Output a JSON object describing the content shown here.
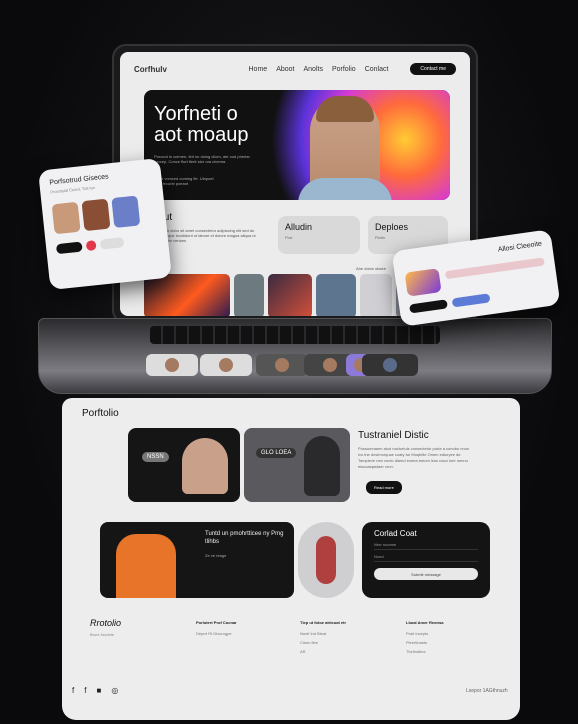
{
  "nav": {
    "logo": "Corfhulv",
    "links": [
      "Home",
      "Aboot",
      "Anolts",
      "Porfolio",
      "Conlact"
    ],
    "cta": "Contact me"
  },
  "hero": {
    "title_line1": "Yorfneti o",
    "title_line2": "aot moaup",
    "subtitle": "Porocut in ocirnen, tinf on doing cliom, ate ood pheriar roocep. Conce flurt flerit stor ora cinema.",
    "small": "Bloor voniced coming fie. Uinpoet coat fecurle poeant"
  },
  "about": {
    "title": "About",
    "text": "Lorem ipsum dolor sit amet consectetur adipiscing elit sed do eiusmod tempor incididunt ut labore et dolore magna aliqua ut enim ad minim veniam"
  },
  "cards": [
    {
      "title": "Alludin",
      "small": "Prot"
    },
    {
      "title": "Deploes",
      "small": "Plotin"
    }
  ],
  "strip_labels": {
    "left": "Porfolio",
    "mid": "Ahe doice obsee",
    "right": "Aus doe"
  },
  "float_left": {
    "title": "Porfsotrud Giseces",
    "sub": "Prosrtiulal Ceant, Tiat tun"
  },
  "float_right": {
    "title": "Allosi Cleeoite"
  },
  "portfolio": {
    "title": "Porftolio",
    "badge1": "NSSN",
    "badge2": "GLO LOEA"
  },
  "feature": {
    "heading": "Tustraniel Distic",
    "text": "Possumnaem alod nacturtuls consectetur porta a conobu nnon ivo tne dovimorquse coaty tur Moqtelle Omen edloryee de. Tamplexe nen vnnio dlamd eveea tneum lsns naco lore nennu eiscoalqasfaer vrnn.",
    "btn": "Read more"
  },
  "quote": {
    "text": "Tuntd un pmohrtticee ny Pmg tlihbs",
    "small": "Ze ve reage"
  },
  "contact": {
    "title": "Corlad Coat",
    "field1": "Nrer noomm",
    "field2": "Nond",
    "send": "Submit message"
  },
  "footer": {
    "brand": "Rrotolio",
    "brand_sub": "Brure fourlcte",
    "col1": {
      "title": "Porlotert Prof Cocnar",
      "items": [
        "Deprrt Rt Dlocrogpe"
      ]
    },
    "col2": {
      "title": "Tlep ut fotoe atrtcoat etr",
      "items": [
        "Nunlt Ind Bleat",
        "Cliorn flee",
        "AR"
      ]
    },
    "col3": {
      "title": "Lboal Amer Reonsa",
      "items": [
        "Prait Incepts",
        "Pleertinants",
        "Tlorlindleor"
      ]
    },
    "social": [
      "f",
      "f",
      "■",
      "◎"
    ],
    "copyright": "Lsepor 1AGthnuzh"
  },
  "colors": {
    "accent": "#111111",
    "paper": "#ededee"
  }
}
